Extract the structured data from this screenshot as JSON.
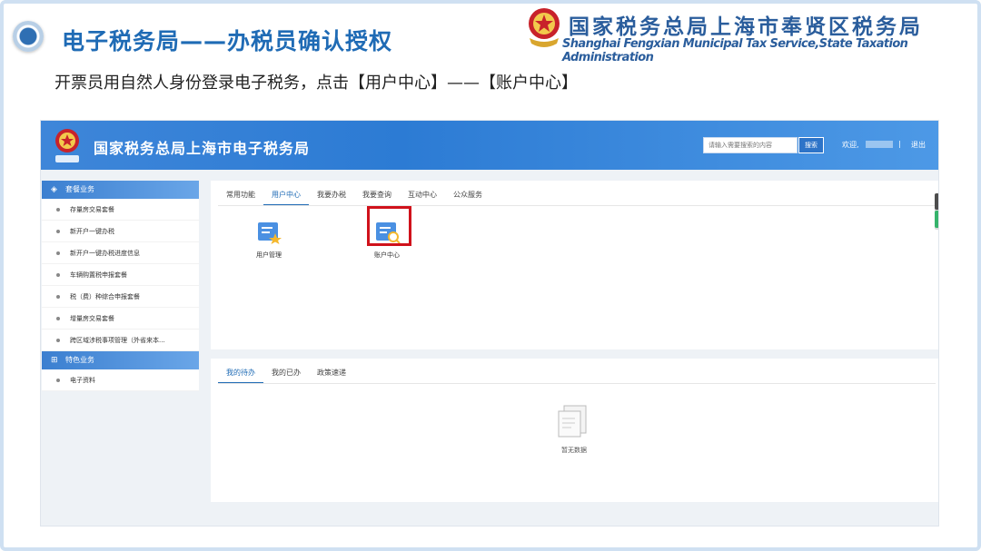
{
  "slide": {
    "title": "电子税务局——办税员确认授权",
    "subtitle": "开票员用自然人身份登录电子税务，点击【用户中心】——【账户中心】"
  },
  "brand": {
    "cn_name": "国家税务总局上海市奉贤区税务局",
    "en_name": "Shanghai Fengxian Municipal Tax Service,State Taxation Administration"
  },
  "portal": {
    "title": "国家税务总局上海市电子税务局",
    "search_placeholder": "请输入需要搜索的内容",
    "search_button": "搜索",
    "welcome": "欢迎,",
    "separator": "|",
    "logout": "退出"
  },
  "sidebar": {
    "group1": "套餐业务",
    "group1_items": [
      "存量房交易套餐",
      "新开户一键办税",
      "新开户一键办税进度信息",
      "车辆购置税申报套餐",
      "税（费）种综合申报套餐",
      "增量房交易套餐",
      "跨区域涉税事项管理（外省来本..."
    ],
    "group2": "特色业务",
    "group2_items": [
      "电子资料"
    ]
  },
  "main": {
    "tabs": [
      "常用功能",
      "用户中心",
      "我要办税",
      "我要查询",
      "互动中心",
      "公众服务"
    ],
    "active_tab": "用户中心",
    "apps": [
      {
        "label": "用户管理",
        "icon": "user-management-icon"
      },
      {
        "label": "账户中心",
        "icon": "account-center-icon"
      }
    ]
  },
  "tasks": {
    "tabs": [
      "我的待办",
      "我的已办",
      "政策速递"
    ],
    "active_tab": "我的待办",
    "empty_text": "暂无数据"
  },
  "colors": {
    "accent": "#1f6bb5",
    "topbar": "#2c7bd4",
    "highlight": "#d0121b"
  }
}
